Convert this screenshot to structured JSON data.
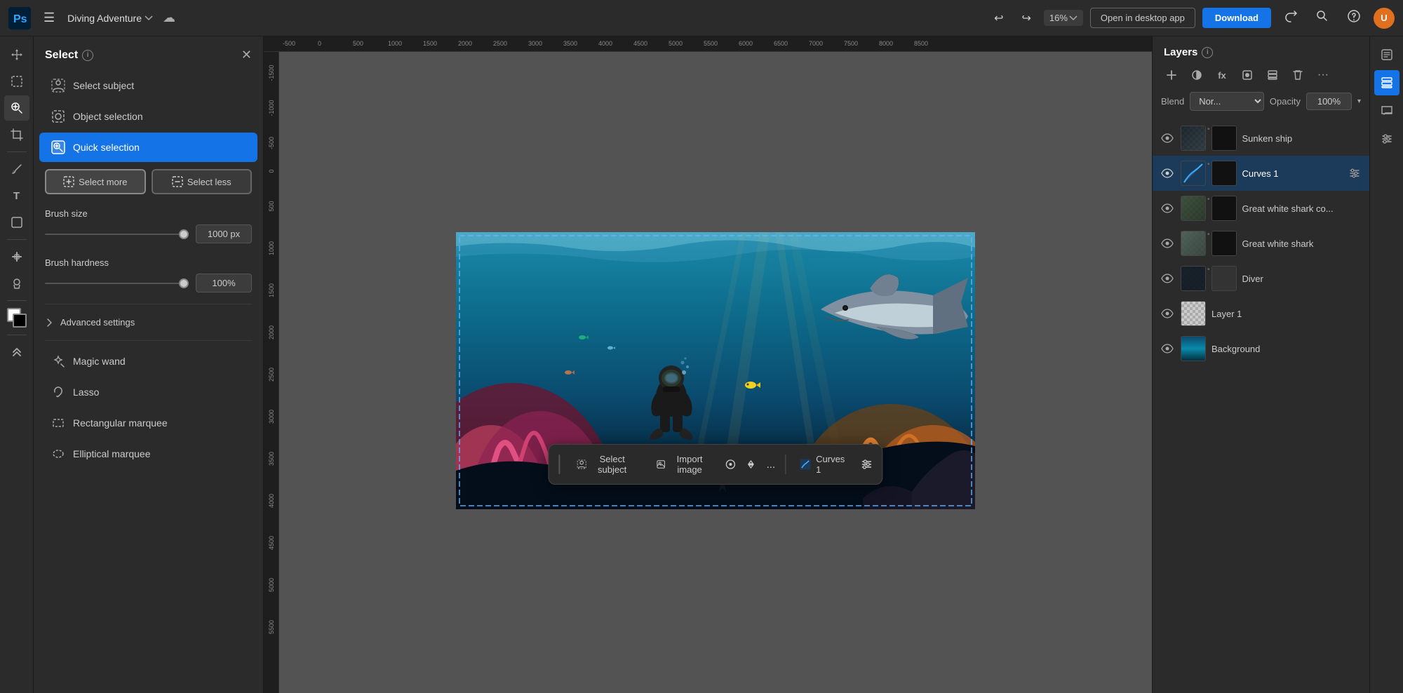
{
  "app": {
    "logo_text": "Ps",
    "title": "Diving Adventure",
    "title_dropdown": "▾"
  },
  "topbar": {
    "menu_icon": "☰",
    "zoom_value": "16%",
    "open_desktop_label": "Open in desktop app",
    "download_label": "Download",
    "share_icon": "↑",
    "search_icon": "🔍",
    "help_icon": "?",
    "avatar_label": "U"
  },
  "left_tools": [
    {
      "id": "move",
      "icon": "✛",
      "active": false
    },
    {
      "id": "selection",
      "icon": "⬚",
      "active": false
    },
    {
      "id": "quick-select",
      "icon": "◉",
      "active": true
    },
    {
      "id": "crop",
      "icon": "⊕",
      "active": false
    },
    {
      "id": "brush",
      "icon": "✏",
      "active": false
    },
    {
      "id": "text",
      "icon": "T",
      "active": false
    },
    {
      "id": "shape",
      "icon": "◻",
      "active": false
    },
    {
      "id": "pen",
      "icon": "✒",
      "active": false
    },
    {
      "id": "gradient",
      "icon": "◑",
      "active": false
    },
    {
      "id": "collapse",
      "icon": "«",
      "active": false
    }
  ],
  "panel": {
    "title": "Select",
    "items": [
      {
        "id": "select-subject",
        "label": "Select subject",
        "icon": "person"
      },
      {
        "id": "object-selection",
        "label": "Object selection",
        "icon": "object"
      },
      {
        "id": "quick-selection",
        "label": "Quick selection",
        "icon": "quick",
        "active": true
      },
      {
        "id": "magic-wand",
        "label": "Magic wand",
        "icon": "wand"
      },
      {
        "id": "lasso",
        "label": "Lasso",
        "icon": "lasso"
      },
      {
        "id": "rect-marquee",
        "label": "Rectangular marquee",
        "icon": "rect"
      },
      {
        "id": "ellip-marquee",
        "label": "Elliptical marquee",
        "icon": "ellip"
      }
    ],
    "select_more_label": "Select more",
    "select_less_label": "Select less",
    "brush_size_label": "Brush size",
    "brush_size_value": "1000 px",
    "brush_hardness_label": "Brush hardness",
    "brush_hardness_value": "100%",
    "advanced_settings_label": "Advanced settings"
  },
  "layers": {
    "title": "Layers",
    "blend_label": "Blend",
    "blend_value": "Nor...",
    "opacity_label": "Opacity",
    "opacity_value": "100%",
    "items": [
      {
        "id": "sunken-ship",
        "name": "Sunken ship",
        "thumb_type": "mixed",
        "active": false
      },
      {
        "id": "curves-1",
        "name": "Curves 1",
        "thumb_type": "curves",
        "active": true
      },
      {
        "id": "great-white-co",
        "name": "Great white shark co...",
        "thumb_type": "shark-co",
        "active": false
      },
      {
        "id": "great-white",
        "name": "Great white shark",
        "thumb_type": "shark",
        "active": false
      },
      {
        "id": "diver",
        "name": "Diver",
        "thumb_type": "diver",
        "active": false
      },
      {
        "id": "layer-1",
        "name": "Layer 1",
        "thumb_type": "white",
        "active": false
      },
      {
        "id": "background",
        "name": "Background",
        "thumb_type": "bg",
        "active": false
      }
    ]
  },
  "bottom_bar": {
    "select_subject_label": "Select subject",
    "import_image_label": "Import image",
    "curves_label": "Curves 1",
    "more_options": "..."
  },
  "canvas": {
    "zoom": "16%"
  }
}
